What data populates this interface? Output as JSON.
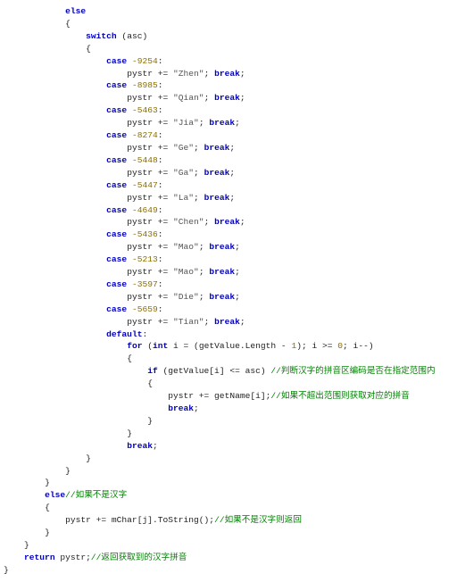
{
  "kw": {
    "else": "else",
    "switch": "switch",
    "case": "case",
    "break": "break",
    "default": "default",
    "for": "for",
    "int": "int",
    "if": "if",
    "return": "return"
  },
  "switch_expr": "asc",
  "cases": [
    {
      "num": "-9254",
      "expr": "pystr += ",
      "str": "\"Zhen\""
    },
    {
      "num": "-8985",
      "expr": "pystr += ",
      "str": "\"Qian\""
    },
    {
      "num": "-5463",
      "expr": "pystr += ",
      "str": "\"Jia\""
    },
    {
      "num": "-8274",
      "expr": "pystr += ",
      "str": "\"Ge\""
    },
    {
      "num": "-5448",
      "expr": "pystr += ",
      "str": "\"Ga\""
    },
    {
      "num": "-5447",
      "expr": "pystr += ",
      "str": "\"La\""
    },
    {
      "num": "-4649",
      "expr": "pystr += ",
      "str": "\"Chen\""
    },
    {
      "num": "-5436",
      "expr": "pystr += ",
      "str": "\"Mao\""
    },
    {
      "num": "-5213",
      "expr": "pystr += ",
      "str": "\"Mao\""
    },
    {
      "num": "-3597",
      "expr": "pystr += ",
      "str": "\"Die\""
    },
    {
      "num": "-5659",
      "expr": "pystr += ",
      "str": "\"Tian\""
    }
  ],
  "for_header_a": "i = (getValue.Length - ",
  "for_one": "1",
  "for_header_b": "); i >= ",
  "for_zero": "0",
  "for_header_c": "; i--)",
  "if_cond": "(getValue[i] <= asc) ",
  "cmt_if": "//判断汉字的拼音区编码是否在指定范围内",
  "inner_assign": "pystr += getName[i];",
  "cmt_inner": "//如果不超出范围则获取对应的拼音",
  "else_cmt": "//如果不是汉字",
  "else_body": "pystr += mChar[j].ToString();",
  "cmt_else_body": "//如果不是汉字则返回",
  "return_expr": "pystr;",
  "cmt_return": "//返回获取到的汉字拼音",
  "sym": {
    "ob": "{",
    "cb": "}",
    "semi": ";",
    "colon": ":"
  }
}
